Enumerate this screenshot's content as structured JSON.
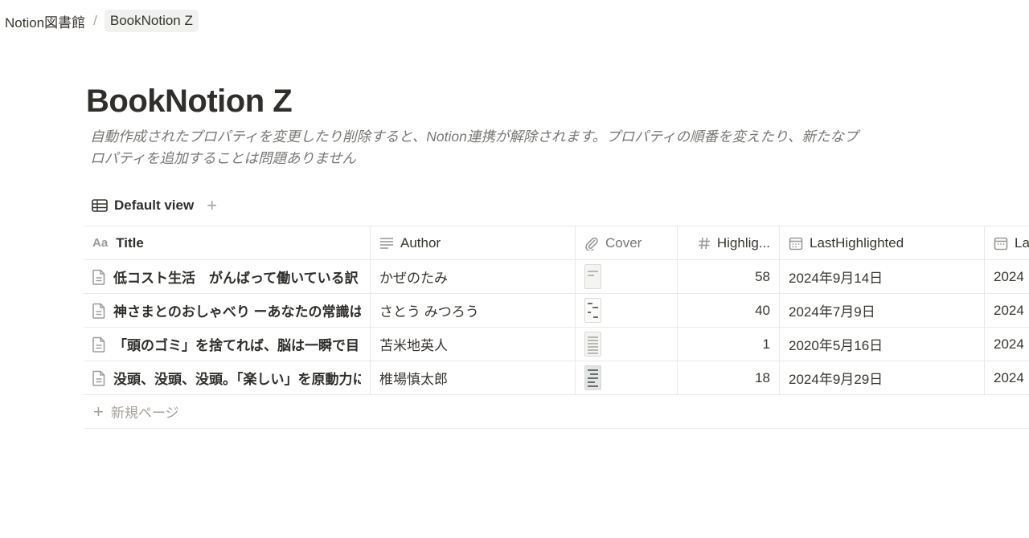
{
  "breadcrumb": {
    "parent": "Notion図書館",
    "separator": "/",
    "current": "BookNotion Z"
  },
  "page": {
    "title": "BookNotion Z",
    "description_line1": "自動作成されたプロパティを変更したり削除すると、Notion連携が解除されます。プロパティの順番を変えたり、新たなプ",
    "description_line2": "ロパティを追加することは問題ありません"
  },
  "views": {
    "active_label": "Default view",
    "add_label": "+"
  },
  "table": {
    "columns": {
      "title_prefix": "Aa",
      "title": "Title",
      "author": "Author",
      "cover": "Cover",
      "highlights": "Highlig...",
      "last_highlighted": "LastHighlighted",
      "last_clipped": "La"
    },
    "rows": [
      {
        "title": "低コスト生活　がんばって働いている訳",
        "author": "かぜのたみ",
        "highlights": "58",
        "last_highlighted": "2024年9月14日",
        "last_clipped": "2024"
      },
      {
        "title": "神さまとのおしゃべり ーあなたの常識は",
        "author": "さとう みつろう",
        "highlights": "40",
        "last_highlighted": "2024年7月9日",
        "last_clipped": "2024"
      },
      {
        "title": "「頭のゴミ」を捨てれば、脳は一瞬で目",
        "author": "苫米地英人",
        "highlights": "1",
        "last_highlighted": "2020年5月16日",
        "last_clipped": "2024"
      },
      {
        "title": "没頭、没頭、没頭。「楽しい」を原動力に",
        "author": "椎場慎太郎",
        "highlights": "18",
        "last_highlighted": "2024年9月29日",
        "last_clipped": "2024"
      }
    ],
    "new_page_label": "新規ページ"
  },
  "icons": {
    "table_view": "table-icon",
    "text_property": "text-lines-icon",
    "file_property": "paperclip-icon",
    "number_property": "hash-icon",
    "date_property": "calendar-icon",
    "page": "page-icon"
  }
}
